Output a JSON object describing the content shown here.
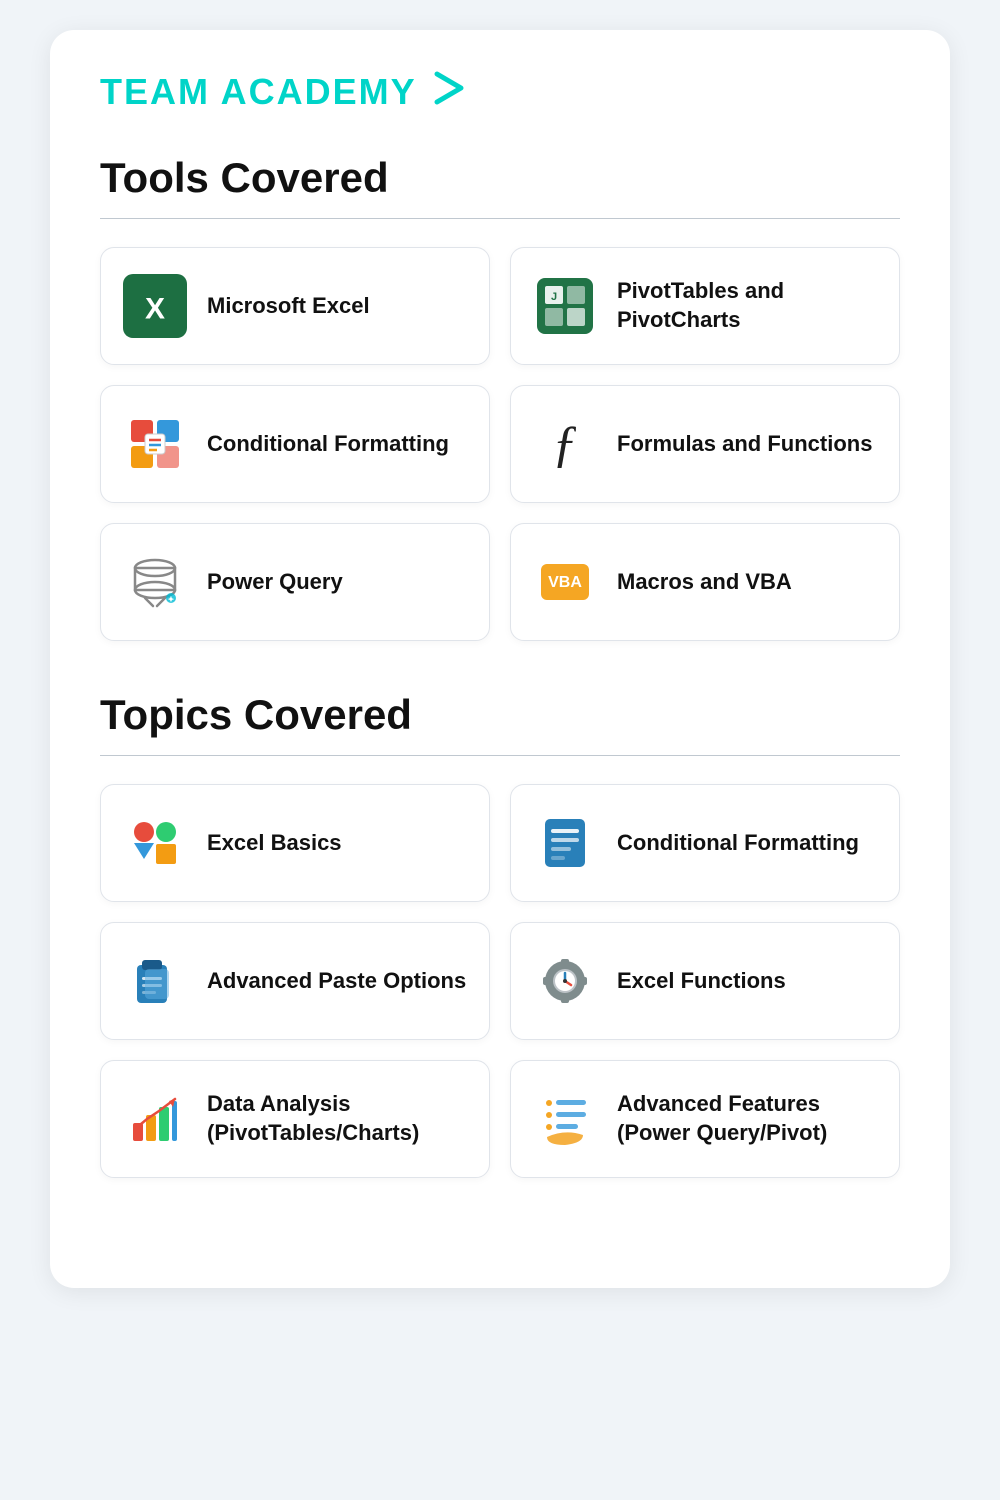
{
  "header": {
    "logo": "TEAM ACADEMY",
    "chevron": "›"
  },
  "tools_section": {
    "title": "Tools Covered",
    "items": [
      {
        "id": "microsoft-excel",
        "label": "Microsoft Excel",
        "icon": "excel"
      },
      {
        "id": "pivottables",
        "label": "PivotTables and PivotCharts",
        "icon": "pivot"
      },
      {
        "id": "conditional-formatting",
        "label": "Conditional Formatting",
        "icon": "cf"
      },
      {
        "id": "formulas-functions",
        "label": "Formulas and Functions",
        "icon": "formula"
      },
      {
        "id": "power-query",
        "label": "Power Query",
        "icon": "pq"
      },
      {
        "id": "macros-vba",
        "label": "Macros and VBA",
        "icon": "vba"
      }
    ]
  },
  "topics_section": {
    "title": "Topics Covered",
    "items": [
      {
        "id": "excel-basics",
        "label": "Excel Basics",
        "icon": "basics"
      },
      {
        "id": "conditional-formatting-topic",
        "label": "Conditional Formatting",
        "icon": "condformat"
      },
      {
        "id": "advanced-paste",
        "label": "Advanced Paste Options",
        "icon": "paste"
      },
      {
        "id": "excel-functions",
        "label": "Excel Functions",
        "icon": "excelfunc"
      },
      {
        "id": "data-analysis",
        "label": "Data Analysis (PivotTables/Charts)",
        "icon": "dataanalysis"
      },
      {
        "id": "advanced-features",
        "label": "Advanced Features (Power Query/Pivot)",
        "icon": "advfeatures"
      }
    ]
  }
}
